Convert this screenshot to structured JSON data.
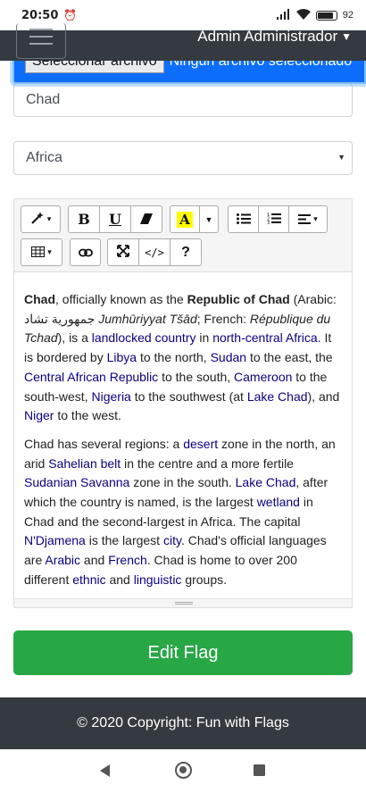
{
  "status_bar": {
    "time": "20:50",
    "battery": "92"
  },
  "navbar": {
    "user": "Admin Administrador"
  },
  "file_input": {
    "button_label": "Seleccionar archivo",
    "status": "Ningún archivo seleccionado"
  },
  "form": {
    "country_name": "Chad",
    "continent": "Africa"
  },
  "editor": {
    "paragraph1": [
      {
        "t": "Chad",
        "b": true
      },
      {
        "t": ", officially known as the "
      },
      {
        "t": "Republic of Chad",
        "b": true
      },
      {
        "t": " (Arabic: "
      },
      {
        "t": "جمهورية تشاد"
      },
      {
        "t": " "
      },
      {
        "t": "Jumhūriyyat Tšād",
        "i": true
      },
      {
        "t": "; French: "
      },
      {
        "t": "République du Tchad",
        "i": true
      },
      {
        "t": "), is a "
      },
      {
        "t": "landlocked country",
        "l": true
      },
      {
        "t": " in "
      },
      {
        "t": "north-central Africa",
        "l": true
      },
      {
        "t": ". It is bordered by "
      },
      {
        "t": "Libya",
        "l": true
      },
      {
        "t": " to the north, "
      },
      {
        "t": "Sudan",
        "l": true
      },
      {
        "t": " to the east, the "
      },
      {
        "t": "Central African Republic",
        "l": true
      },
      {
        "t": " to the south, "
      },
      {
        "t": "Cameroon",
        "l": true
      },
      {
        "t": " to the south-west, "
      },
      {
        "t": "Nigeria",
        "l": true
      },
      {
        "t": " to the southwest (at "
      },
      {
        "t": "Lake Chad",
        "l": true
      },
      {
        "t": "), and "
      },
      {
        "t": "Niger",
        "l": true
      },
      {
        "t": " to the west."
      }
    ],
    "paragraph2": [
      {
        "t": "Chad has several regions: a "
      },
      {
        "t": "desert",
        "l": true
      },
      {
        "t": " zone in the north, an arid "
      },
      {
        "t": "Sahelian belt",
        "l": true
      },
      {
        "t": " in the centre and a more fertile "
      },
      {
        "t": "Sudanian Savanna",
        "l": true
      },
      {
        "t": " zone in the south. "
      },
      {
        "t": "Lake Chad",
        "l": true
      },
      {
        "t": ", after which the country is named, is the largest "
      },
      {
        "t": "wetland",
        "l": true
      },
      {
        "t": " in Chad and the second-largest in Africa. The capital "
      },
      {
        "t": "N'Djamena",
        "l": true
      },
      {
        "t": " is the largest "
      },
      {
        "t": "city",
        "l": true
      },
      {
        "t": ". Chad's official languages are "
      },
      {
        "t": "Arabic",
        "l": true
      },
      {
        "t": " and "
      },
      {
        "t": "French",
        "l": true
      },
      {
        "t": ". Chad is home to over 200 different "
      },
      {
        "t": "ethnic",
        "l": true
      },
      {
        "t": " and "
      },
      {
        "t": "linguistic",
        "l": true
      },
      {
        "t": " groups."
      }
    ],
    "toolbar": {
      "bold": "B",
      "underline": "U",
      "highlight": "A",
      "help": "?"
    }
  },
  "submit": {
    "label": "Edit Flag"
  },
  "footer": {
    "text": "© 2020 Copyright: Fun with Flags"
  },
  "colors": {
    "navbar": "#343a40",
    "submit": "#28a745",
    "file_strip": "#0d6efd",
    "link": "#0b0080"
  }
}
